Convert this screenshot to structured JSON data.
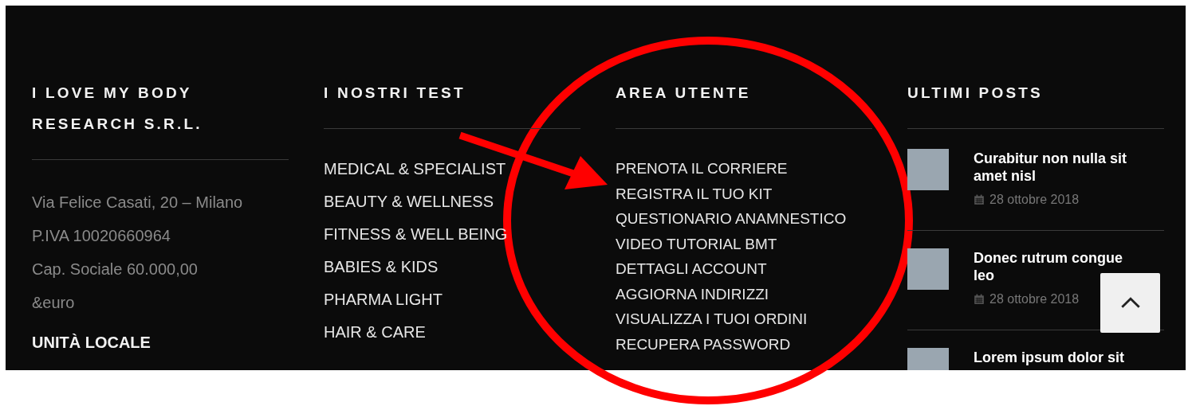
{
  "columns": [
    {
      "kind": "company",
      "title": "I LOVE MY BODY RESEARCH S.R.L.",
      "lines": [
        "Via Felice Casati, 20 – Milano",
        "P.IVA 10020660964",
        "Cap. Sociale 60.000,00",
        "&euro"
      ],
      "subtitle": "UNITÀ LOCALE"
    },
    {
      "kind": "links",
      "title": "I NOSTRI TEST",
      "links": [
        "MEDICAL & SPECIALIST",
        "BEAUTY & WELLNESS",
        "FITNESS & WELL BEING",
        "BABIES & KIDS",
        "PHARMA LIGHT",
        "HAIR & CARE"
      ]
    },
    {
      "kind": "compact-links",
      "title": "AREA UTENTE",
      "links": [
        "PRENOTA IL CORRIERE",
        "REGISTRA IL TUO KIT",
        "QUESTIONARIO ANAMNESTICO",
        "VIDEO TUTORIAL BMT",
        "DETTAGLI ACCOUNT",
        "AGGIORNA INDIRIZZI",
        "VISUALIZZA I TUOI ORDINI",
        "RECUPERA PASSWORD"
      ]
    },
    {
      "kind": "posts",
      "title": "ULTIMI POSTS",
      "posts": [
        {
          "title": "Curabitur non nulla sit amet nisl",
          "date": "28 ottobre 2018"
        },
        {
          "title": "Donec rutrum congue leo",
          "date": "28 ottobre 2018"
        },
        {
          "title": "Lorem ipsum dolor sit"
        }
      ]
    }
  ],
  "annotation": {
    "kind": "circle-with-arrow"
  }
}
